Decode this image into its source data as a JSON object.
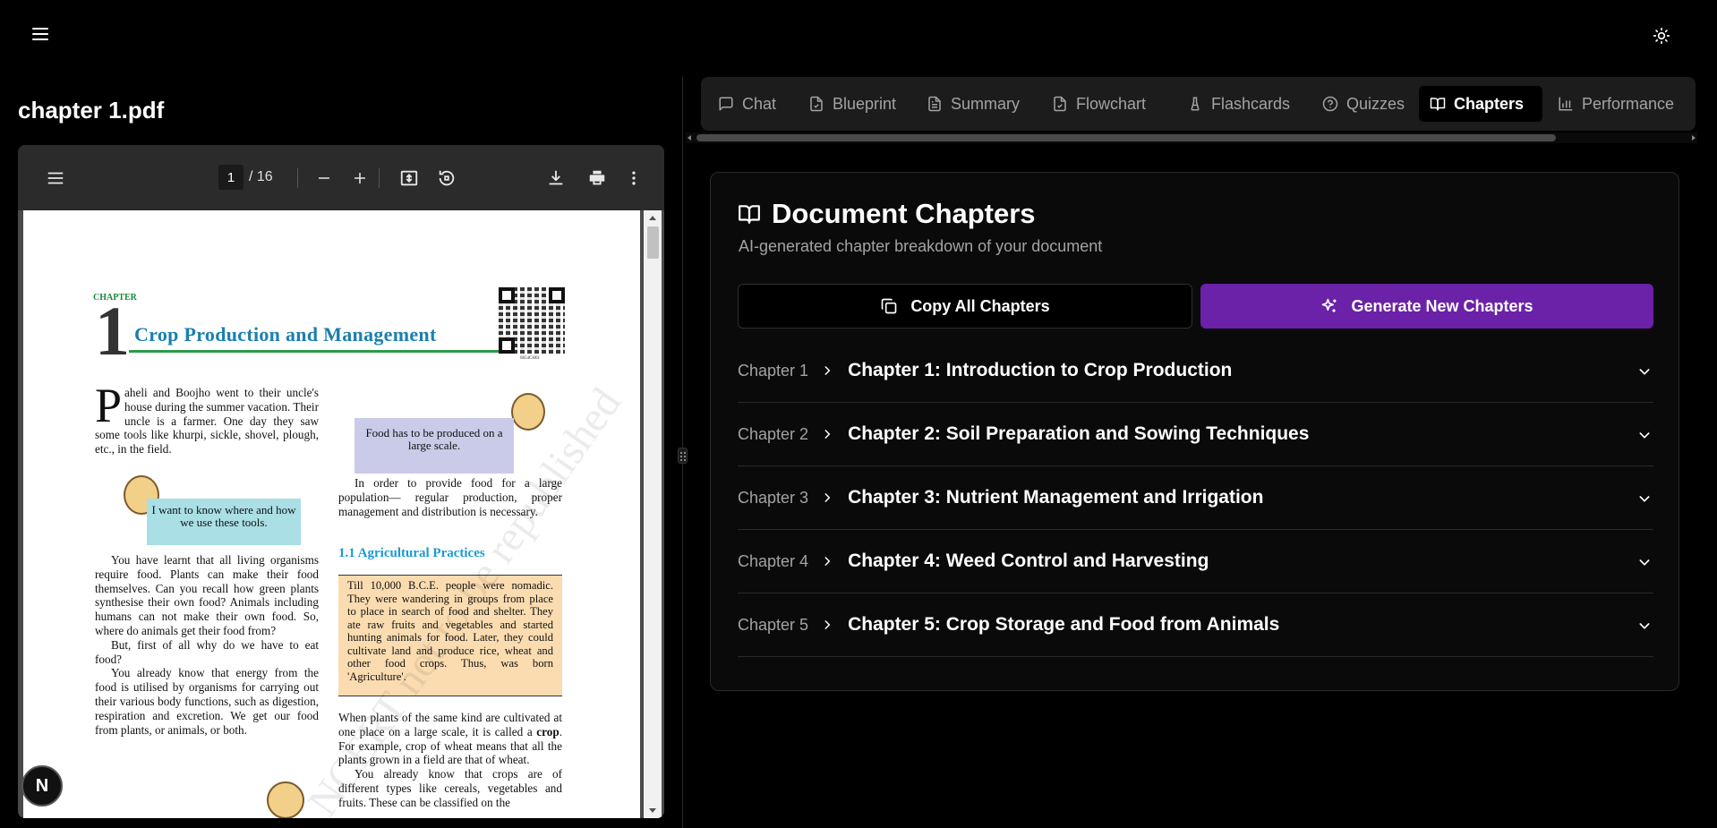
{
  "header": {
    "menu_icon": "hamburger-menu-icon",
    "theme_icon": "sun-icon"
  },
  "document": {
    "title": "chapter 1.pdf"
  },
  "pdf_viewer": {
    "current_page": "1",
    "total_pages": "/ 16",
    "page": {
      "chapter_word": "CHAPTER",
      "chapter_number": "1",
      "chapter_title": "Crop Production and Management",
      "qr_code_id": "0854CH01",
      "intro_paragraph": "aheli and Boojho went to their uncle's house during the summer vacation. Their uncle is a farmer. One day they saw some tools like khurpi, sickle, shovel, plough, etc., in the field.",
      "dropcap": "P",
      "bubble_girl": "Food has to be produced on a large scale.",
      "bubble_boy": "I want to know where and how we use these tools.",
      "right_para_1": "In order to provide food for a large population— regular production, proper management and distribution is necessary.",
      "section_heading": "1.1 Agricultural Practices",
      "box_text": "Till 10,000 B.C.E. people were nomadic. They were wandering in groups from place to place in search of food and shelter. They ate raw fruits and vegetables and started hunting animals for food. Later, they could cultivate land and produce rice, wheat and other food crops. Thus, was born 'Agriculture'.",
      "left_para_2": "You have learnt that all living organisms require food. Plants can make their food themselves. Can you recall how green plants synthesise their own food? Animals including humans can not make their own food. So, where do animals get their food from?",
      "left_para_3": "But, first of all why do we have to eat food?",
      "left_para_4": "You already know that energy from the food is utilised by organisms for carrying out their various body functions, such as digestion, respiration and excretion. We get our food from plants, or animals, or both.",
      "right_para_2a": "When plants of the same kind are cultivated at one place on a large scale, it is called a ",
      "right_para_2b": "crop",
      "right_para_2c": ". For example, crop of wheat means that all the plants grown in a field are that of wheat.",
      "right_para_3": "You already know that crops are of different types like cereals, vegetables and fruits. These can be classified on the",
      "watermark": "© NCERT not to be republished"
    },
    "badge_letter": "N"
  },
  "tabs": [
    {
      "label": "Chat",
      "icon": "chat-bubble-icon"
    },
    {
      "label": "Blueprint",
      "icon": "file-check-icon"
    },
    {
      "label": "Summary",
      "icon": "file-text-icon"
    },
    {
      "label": "Flowchart",
      "icon": "file-check-icon"
    },
    {
      "label": "Flashcards",
      "icon": "flask-icon"
    },
    {
      "label": "Quizzes",
      "icon": "help-circle-icon"
    },
    {
      "label": "Chapters",
      "icon": "book-open-icon",
      "active": true
    },
    {
      "label": "Performance",
      "icon": "bar-chart-icon"
    }
  ],
  "chapters_panel": {
    "title": "Document Chapters",
    "subtitle": "AI-generated chapter breakdown of your document",
    "copy_button": "Copy All Chapters",
    "generate_button": "Generate New Chapters",
    "accent_color": "#6b21a8",
    "items": [
      {
        "label": "Chapter 1",
        "title": "Chapter 1: Introduction to Crop Production"
      },
      {
        "label": "Chapter 2",
        "title": "Chapter 2: Soil Preparation and Sowing Techniques"
      },
      {
        "label": "Chapter 3",
        "title": "Chapter 3: Nutrient Management and Irrigation"
      },
      {
        "label": "Chapter 4",
        "title": "Chapter 4: Weed Control and Harvesting"
      },
      {
        "label": "Chapter 5",
        "title": "Chapter 5: Crop Storage and Food from Animals"
      }
    ]
  }
}
